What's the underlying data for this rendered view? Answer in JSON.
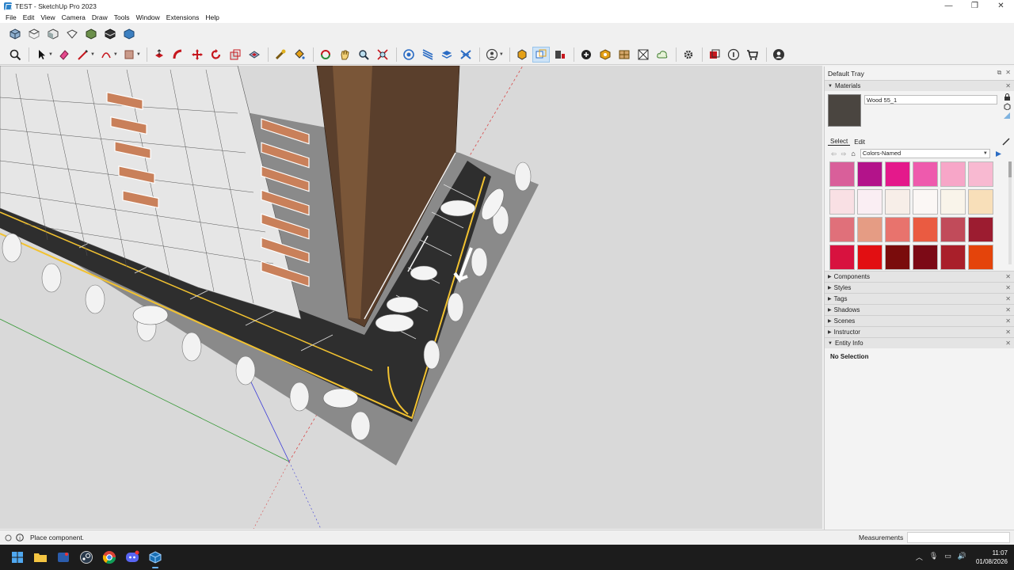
{
  "window": {
    "title": "TEST - SketchUp Pro 2023",
    "controls": {
      "minimize": "—",
      "restore": "❐",
      "close": "✕"
    }
  },
  "menu": [
    "File",
    "Edit",
    "View",
    "Camera",
    "Draw",
    "Tools",
    "Window",
    "Extensions",
    "Help"
  ],
  "toolbar1": {
    "icons": [
      "iso-view-icon",
      "top-view-icon",
      "front-view-icon",
      "right-view-icon",
      "back-view-icon",
      "left-view-icon",
      "bottom-view-icon"
    ]
  },
  "toolbar2": {
    "icons": [
      "zoom-icon",
      "select-icon",
      "eraser-icon",
      "line-icon",
      "arc-icon",
      "rectangle-icon",
      "push-pull-icon",
      "follow-me-icon",
      "move-icon",
      "rotate-icon",
      "scale-icon",
      "offset-icon",
      "tape-measure-icon",
      "paint-bucket-icon",
      "orbit-icon",
      "pan-icon",
      "zoom-window-icon",
      "zoom-extents-icon",
      "section-plane-icon",
      "layers-icon",
      "stack-icon",
      "solid-tools-icon",
      "account-icon",
      "components-icon",
      "3d-warehouse-icon",
      "extension-warehouse-icon",
      "send-to-layout-icon",
      "match-photo-icon",
      "cloud-icon",
      "settings-icon",
      "geo-location-icon",
      "info-icon",
      "cart-icon",
      "user-icon"
    ]
  },
  "tray": {
    "title": "Default Tray",
    "materials": {
      "heading": "Materials",
      "current_name": "Wood 55_1",
      "tab_select": "Select",
      "tab_edit": "Edit",
      "library": "Colors-Named",
      "swatch_colors": [
        "#d95f9a",
        "#b3138a",
        "#e4198b",
        "#ee5aad",
        "#f7a6c8",
        "#f8b9d1",
        "#f9e0e4",
        "#faeef3",
        "#f7eee8",
        "#fbf7f5",
        "#f9f4ea",
        "#f8dfb9",
        "#e0707a",
        "#e59c84",
        "#e8736d",
        "#ea5b41",
        "#c14b5a",
        "#9c1c30",
        "#d8123f",
        "#e20f12",
        "#7a0c0c",
        "#7c0a16",
        "#a91f2a",
        "#e4440b"
      ]
    },
    "panels": [
      "Components",
      "Styles",
      "Tags",
      "Shadows",
      "Scenes",
      "Instructor",
      "Entity Info"
    ],
    "entity_info": {
      "text": "No Selection"
    }
  },
  "status": {
    "message": "Place component.",
    "measurements_label": "Measurements"
  },
  "taskbar": {
    "apps": [
      "windows-start-icon",
      "file-explorer-icon",
      "app-icon",
      "steam-icon",
      "chrome-icon",
      "discord-icon",
      "sketchup-icon"
    ],
    "time": "11:07",
    "date": "01/08/2026"
  }
}
